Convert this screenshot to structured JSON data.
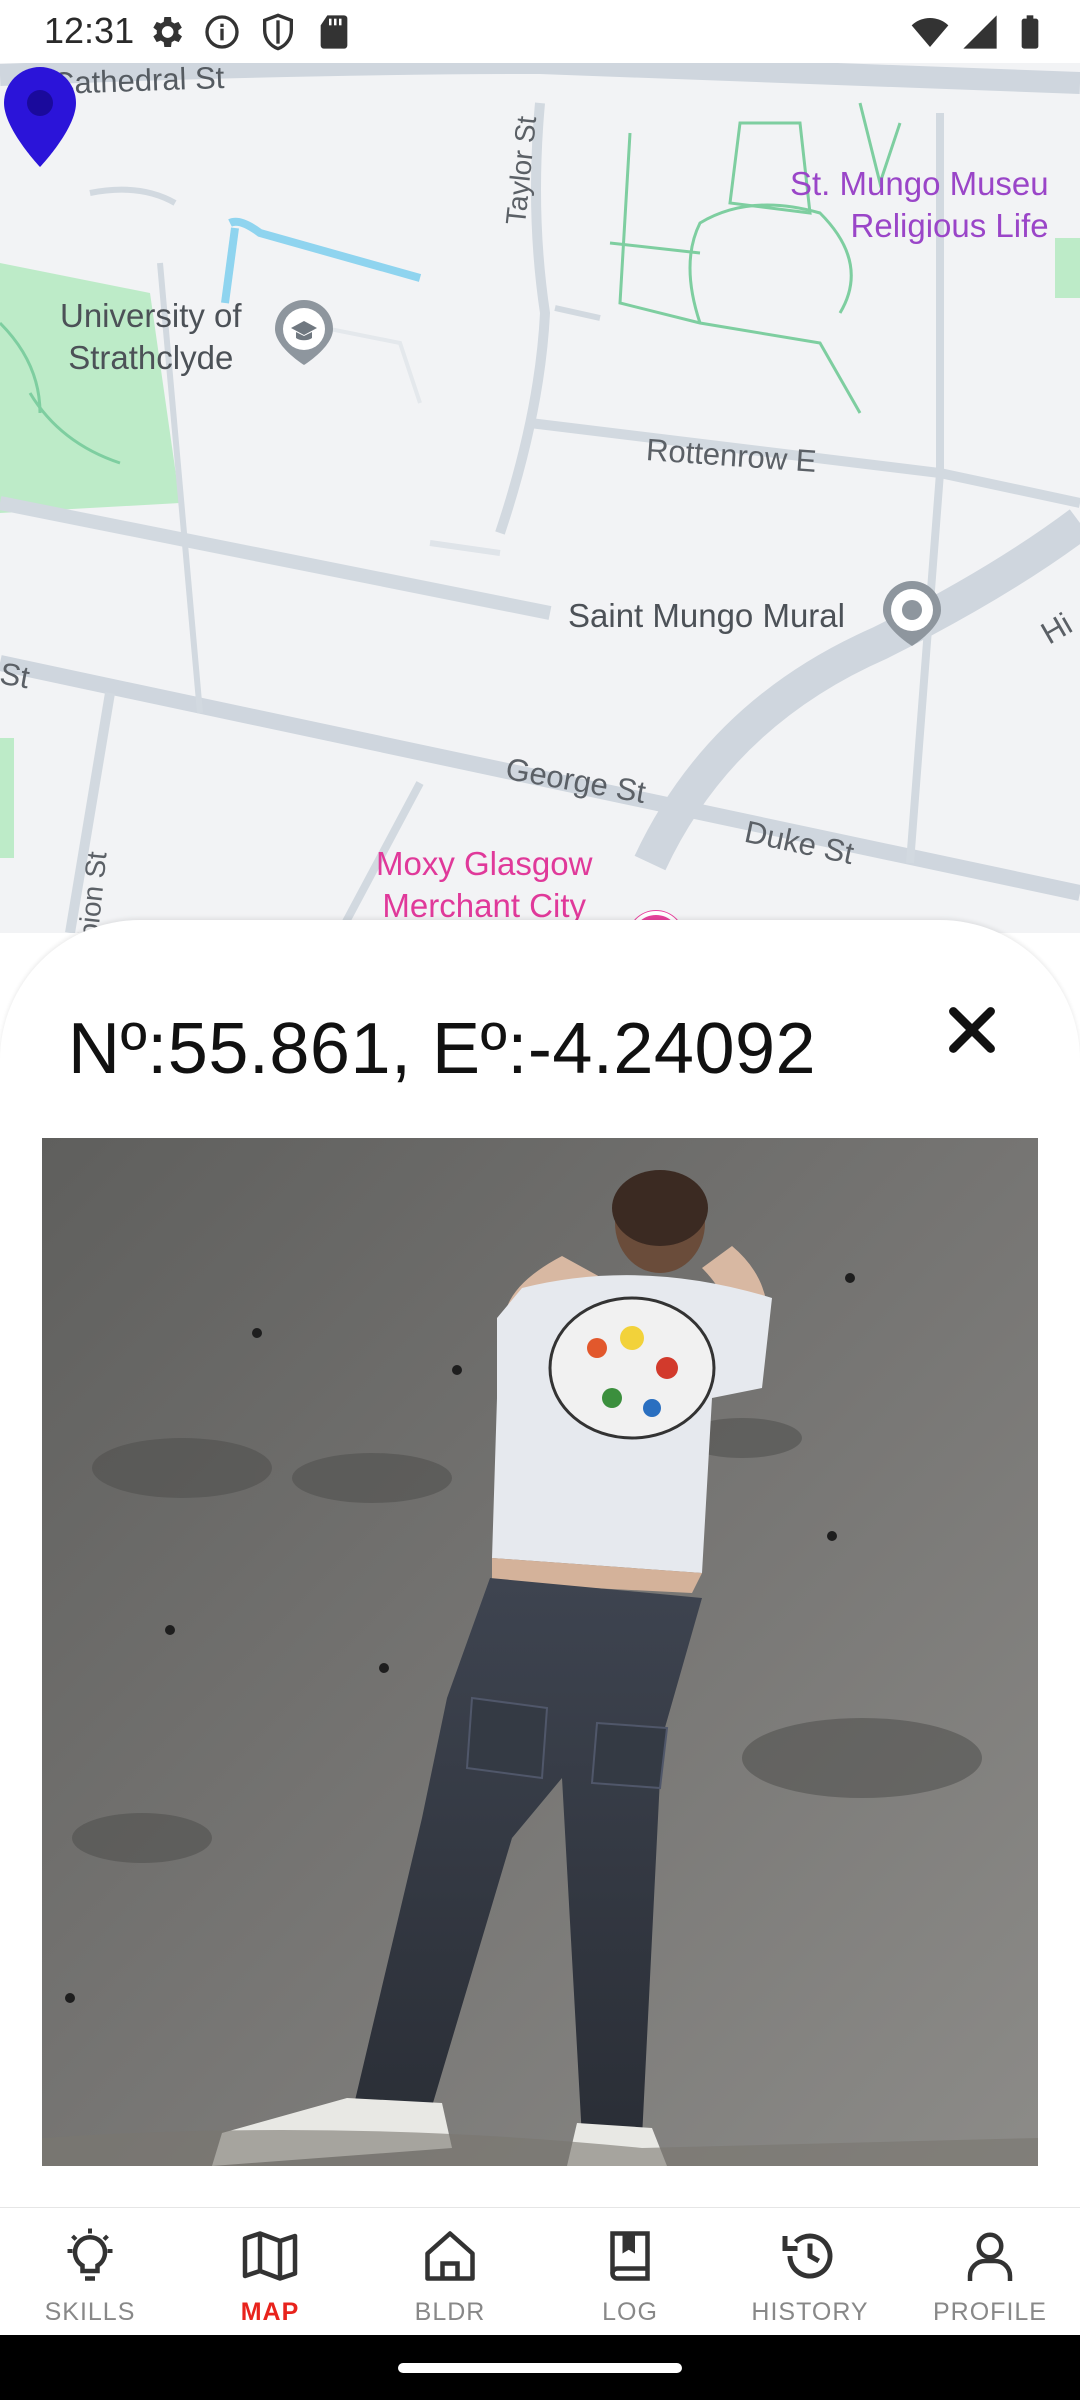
{
  "status_bar": {
    "time": "12:31",
    "left_icons": [
      "gear-icon",
      "info-icon",
      "shield-icon",
      "sd-card-icon"
    ],
    "right_icons": [
      "wifi-icon",
      "signal-icon",
      "battery-icon"
    ]
  },
  "map": {
    "streets": {
      "cathedral": "Cathedral St",
      "taylor": "Taylor St",
      "rottenrow": "Rottenrow E",
      "george": "George St",
      "duke": "Duke St",
      "st_left": "St",
      "albion": "lbion St",
      "hi_right": "Hi"
    },
    "pois": {
      "st_mungo_museum": [
        "St. Mungo Museu",
        "Religious Life"
      ],
      "university": [
        "University of",
        "Strathclyde"
      ],
      "saint_mungo_mural": "Saint Mungo Mural",
      "moxy": [
        "Moxy Glasgow",
        "Merchant City"
      ]
    },
    "colors": {
      "pin": "#2b14d9",
      "park": "#bdebc8",
      "road": "#cfd6de"
    }
  },
  "sheet": {
    "coordinates": "Nº:55.861, Eº:-4.24092",
    "close_icon": "close-icon",
    "photo_description_icon": "photo-image"
  },
  "nav": {
    "items": [
      {
        "label": "SKILLS",
        "icon": "lightbulb-icon",
        "active": false
      },
      {
        "label": "MAP",
        "icon": "map-icon",
        "active": true
      },
      {
        "label": "BLDR",
        "icon": "home-icon",
        "active": false
      },
      {
        "label": "LOG",
        "icon": "book-icon",
        "active": false
      },
      {
        "label": "HISTORY",
        "icon": "history-icon",
        "active": false
      },
      {
        "label": "PROFILE",
        "icon": "person-icon",
        "active": false
      }
    ],
    "active_color": "#e8231c"
  }
}
